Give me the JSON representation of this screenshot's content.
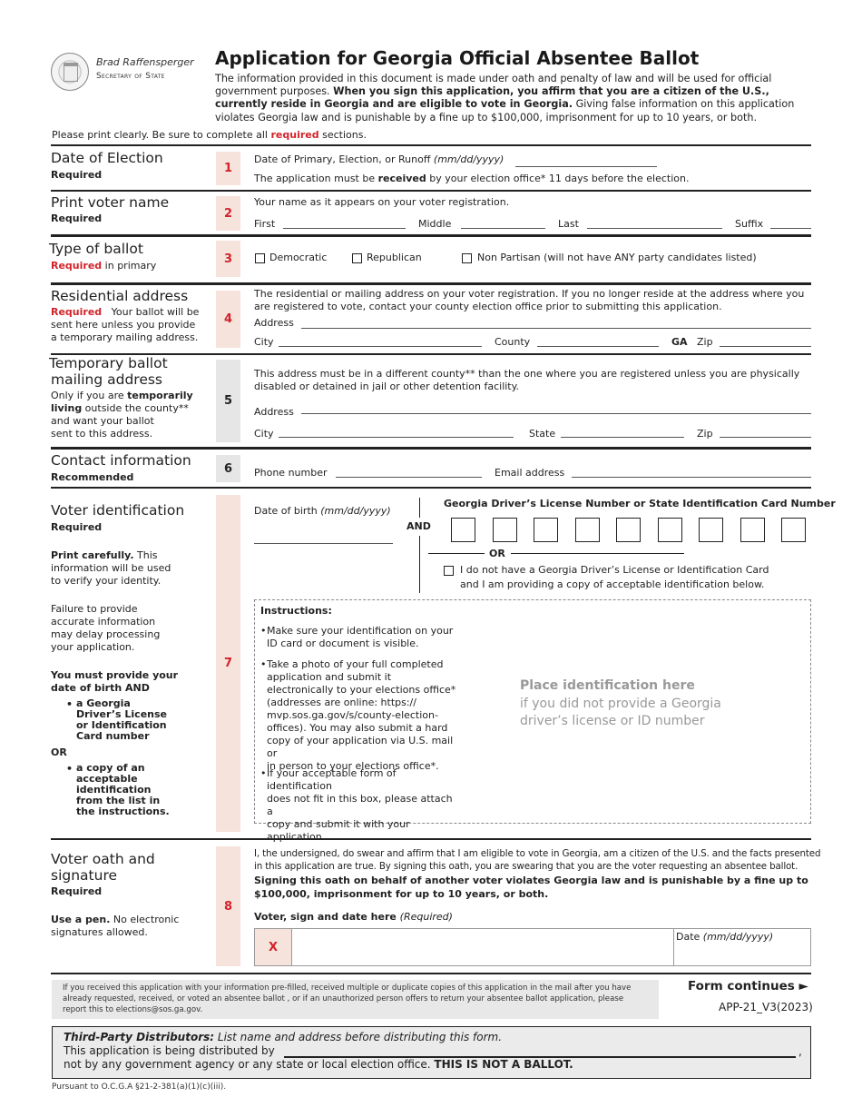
{
  "header": {
    "official_name": "Brad Raffensperger",
    "official_title": "Secretary of State",
    "title": "Application for Georgia Official Absentee Ballot",
    "intro_part1": "The information provided in this document is made under oath and penalty of law and will be used for official government purposes. ",
    "intro_bold": "When you sign this application, you affirm that you are a citizen of the U.S., currently reside in Georgia and are eligible to vote in Georgia.",
    "intro_part2": " Giving false information on this application violates Georgia law and is punishable by a fine up to $100,000, imprisonment for up to 10 years, or both.",
    "print_note_pre": "Please print clearly. Be sure to complete all ",
    "print_note_red": "required",
    "print_note_post": " sections."
  },
  "sections": {
    "s1": {
      "number": "1",
      "title": "Date of Election",
      "status": "Required",
      "date_label": "Date of Primary, Election, or Runoff ",
      "date_format": "(mm/dd/yyyy)",
      "note_pre": "The application must be ",
      "note_bold": "received",
      "note_post": " by your election office* 11 days before the election."
    },
    "s2": {
      "number": "2",
      "title": "Print voter name",
      "status": "Required",
      "instruction": "Your name as it appears on your voter registration.",
      "fields": [
        "First",
        "Middle",
        "Last",
        "Suffix"
      ]
    },
    "s3": {
      "number": "3",
      "title": "Type of ballot",
      "status": "Required",
      "status_suffix": " in primary",
      "options": [
        "Democratic",
        "Republican",
        "Non Partisan (will not have ANY party candidates listed)"
      ]
    },
    "s4": {
      "number": "4",
      "title": "Residential address",
      "status": "Required",
      "status_note": "Your ballot will be",
      "note_line2": "sent here unless you provide",
      "note_line3": "a temporary mailing address.",
      "instruction": "The residential or mailing address on your voter registration. If you no longer reside at the address where you are registered to vote, contact your county election office prior to submitting this application.",
      "address_label": "Address",
      "city_label": "City",
      "county_label": "County",
      "state_value": "GA",
      "zip_label": "Zip"
    },
    "s5": {
      "number": "5",
      "title_line1": "Temporary ballot",
      "title_line2": "mailing address",
      "note_pre": "Only if you are ",
      "note_bold1": "temporarily",
      "note_bold2": "living",
      "note_mid": " outside the county**",
      "note_line3": "and want your ballot",
      "note_line4": "sent to this address.",
      "instruction": "This address must be in a different county** than the one where you are registered unless you are physically disabled or detained in jail or other detention facility.",
      "address_label": "Address",
      "city_label": "City",
      "state_label": "State",
      "zip_label": "Zip"
    },
    "s6": {
      "number": "6",
      "title": "Contact information",
      "status": "Recommended",
      "phone_label": "Phone number",
      "email_label": "Email address"
    },
    "s7": {
      "number": "7",
      "title": "Voter identification",
      "status": "Required",
      "print_bold": "Print carefully.",
      "print_rest1": " This",
      "print_rest2": "information will be used",
      "print_rest3": "to verify your identity.",
      "failure": [
        "Failure to provide",
        "accurate information",
        "may delay processing",
        "your application."
      ],
      "must_line1": "You must provide your",
      "must_line2": "date of birth AND",
      "bullet1": [
        "a Georgia",
        "Driver’s License",
        "or Identification",
        "Card number"
      ],
      "or_label": "OR",
      "bullet2": [
        "a copy of an",
        "acceptable",
        "identification",
        "from the list in",
        "the instructions."
      ],
      "dob_label": "Date of birth ",
      "dob_format": "(mm/dd/yyyy)",
      "and_label": "AND",
      "license_header": "Georgia Driver’s License Number or State Identification Card Number",
      "license_digits": 9,
      "or_divider": "OR",
      "no_license_line1": "I do not have a Georgia Driver’s License or Identification Card",
      "no_license_line2": "and I am providing a copy of acceptable identification below.",
      "instructions_title": "Instructions:",
      "instructions": [
        [
          "Make sure your identification on your",
          "ID card or document is visible."
        ],
        [
          "Take a photo of your full completed",
          "application and submit it",
          "electronically to your elections office*",
          "(addresses are online: https://",
          "mvp.sos.ga.gov/s/county-election-",
          "offices). You may also submit a hard",
          "copy of your  application via U.S. mail or",
          "in person to your elections office*."
        ],
        [
          "If your acceptable form of identification",
          "does not fit in this box, please attach a",
          "copy and submit it with your",
          "application."
        ]
      ],
      "place_heading": "Place identification here",
      "place_sub": "if you did not provide a Georgia driver’s license or ID number"
    },
    "s8": {
      "number": "8",
      "title_line1": "Voter oath and",
      "title_line2": "signature",
      "status": "Required",
      "pen_bold": "Use a pen.",
      "pen_rest1": " No electronic",
      "pen_rest2": "signatures allowed.",
      "oath_line1": "I, the undersigned, do swear and affirm that I am eligible to vote in Georgia, am a citizen of the U.S. and the facts presented",
      "oath_line2": "in this application are true. By signing this oath, you are swearing that you are the voter requesting an absentee ballot.",
      "warning_line1": "Signing this oath on behalf of another voter violates Georgia law and is punishable by a fine up to",
      "warning_line2": "$100,000, imprisonment for up to 10 years, or both.",
      "sign_label": "Voter, sign and date here ",
      "sign_required": "(Required)",
      "sign_mark": "X",
      "date_label": "Date ",
      "date_format": "(mm/dd/yyyy)"
    }
  },
  "footer": {
    "report_notice": "If you received this application with your information pre-filled, received multiple or duplicate copies of this application in the mail after you have already requested, received, or voted an absentee ballot , or if an unauthorized person offers to return your absentee ballot application, please report this to elections@sos.ga.gov.",
    "form_continues": "Form continues ►",
    "form_id": "APP-21_V3(2023)",
    "distributors_label": "Third-Party Distributors:",
    "distributors_instruction": " List name and address before distributing this form.",
    "distributed_by": "This application is being distributed by",
    "not_gov": "not by any government  agency  or  any  state  or  local  election  office.  ",
    "not_ballot": "THIS IS NOT A BALLOT.",
    "pursuant": "Pursuant to O.C.G.A §21-2-381(a)(1)(c)(iii)."
  }
}
